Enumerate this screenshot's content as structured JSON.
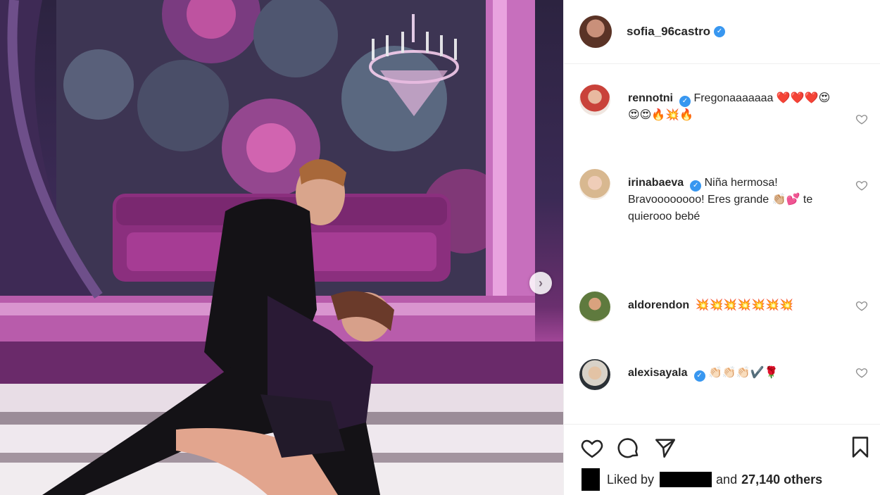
{
  "post": {
    "author": {
      "username": "sofia_96castro",
      "verified": true,
      "avatar_icon": "profile-avatar"
    },
    "carousel": {
      "next_icon": "chevron-right-icon",
      "next_glyph": "›"
    },
    "comments": [
      {
        "username": "rennotni",
        "verified": true,
        "text": "Fregonaaaaaaa ❤️❤️❤️😍😍😍🔥💥🔥",
        "avatar_color": "#c9423a"
      },
      {
        "username": "irinabaeva",
        "verified": true,
        "text": "Niña hermosa! Bravoooooooo! Eres grande 👏🏼💕 te quierooo bebé",
        "avatar_color": "#d8c0a8"
      },
      {
        "username": "aldorendon",
        "verified": false,
        "text": "💥💥💥💥💥💥💥",
        "avatar_color": "#5f7a3e"
      },
      {
        "username": "alexisayala",
        "verified": true,
        "text": "👏🏻👏🏻👏🏻✔️🌹",
        "avatar_color": "#2b3136"
      }
    ],
    "likes": {
      "liked_by_label": "Liked by",
      "and_label": "and",
      "others_count": "27,140 others"
    },
    "icons": {
      "like": "heart-icon",
      "comment": "comment-bubble-icon",
      "share": "paper-plane-icon",
      "save": "bookmark-icon"
    },
    "colors": {
      "verified_blue": "#3897f0",
      "text": "#262626",
      "border": "#efefef"
    }
  }
}
